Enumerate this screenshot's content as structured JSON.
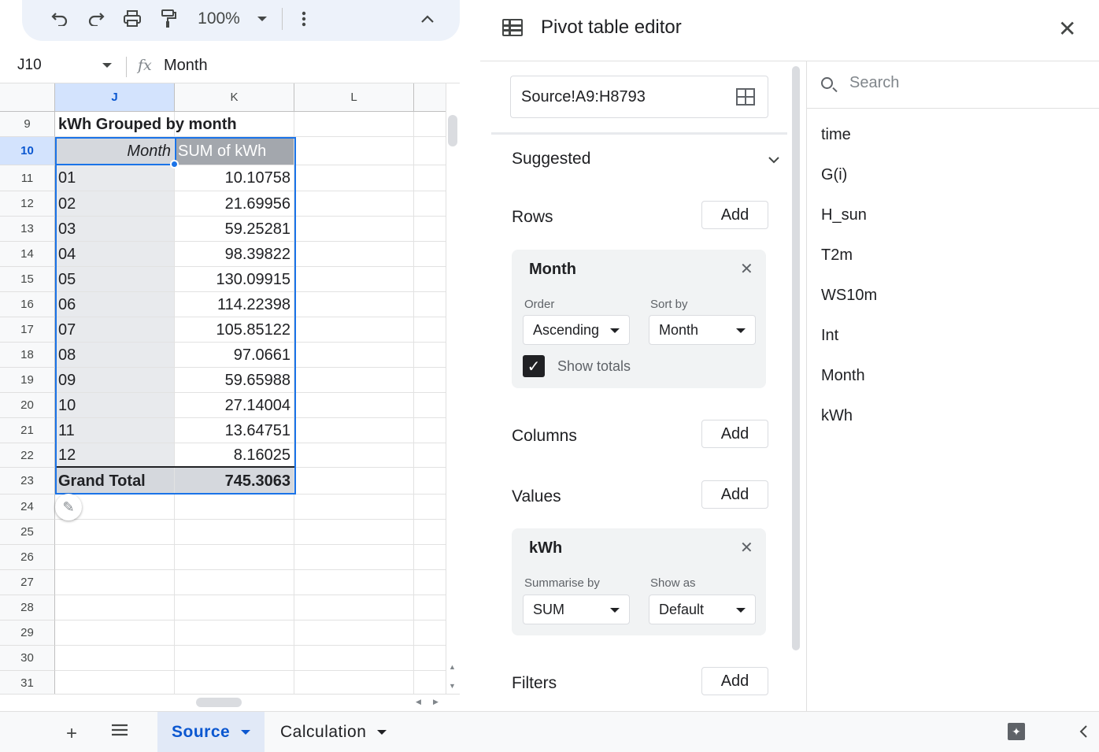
{
  "toolbar": {
    "zoom": "100%",
    "icons": [
      "undo-icon",
      "redo-icon",
      "print-icon",
      "paint-format-icon",
      "zoom-caret-icon",
      "more-vert-icon",
      "collapse-up-icon"
    ]
  },
  "formula_bar": {
    "name_box": "J10",
    "fx": "fx",
    "value": "Month"
  },
  "grid": {
    "columns": [
      "J",
      "K",
      "L"
    ],
    "rows": [
      {
        "num": "9",
        "j": "kWh Grouped by month",
        "k": ""
      },
      {
        "num": "10",
        "j": "Month",
        "k": "SUM of kWh"
      },
      {
        "num": "11",
        "j": "01",
        "k": "10.10758"
      },
      {
        "num": "12",
        "j": "02",
        "k": "21.69956"
      },
      {
        "num": "13",
        "j": "03",
        "k": "59.25281"
      },
      {
        "num": "14",
        "j": "04",
        "k": "98.39822"
      },
      {
        "num": "15",
        "j": "05",
        "k": "130.09915"
      },
      {
        "num": "16",
        "j": "06",
        "k": "114.22398"
      },
      {
        "num": "17",
        "j": "07",
        "k": "105.85122"
      },
      {
        "num": "18",
        "j": "08",
        "k": "97.0661"
      },
      {
        "num": "19",
        "j": "09",
        "k": "59.65988"
      },
      {
        "num": "20",
        "j": "10",
        "k": "27.14004"
      },
      {
        "num": "21",
        "j": "11",
        "k": "13.64751"
      },
      {
        "num": "22",
        "j": "12",
        "k": "8.16025"
      },
      {
        "num": "23",
        "j": "Grand Total",
        "k": "745.3063"
      },
      {
        "num": "24",
        "j": "",
        "k": ""
      },
      {
        "num": "25",
        "j": "",
        "k": ""
      },
      {
        "num": "26",
        "j": "",
        "k": ""
      },
      {
        "num": "27",
        "j": "",
        "k": ""
      },
      {
        "num": "28",
        "j": "",
        "k": ""
      },
      {
        "num": "29",
        "j": "",
        "k": ""
      },
      {
        "num": "30",
        "j": "",
        "k": ""
      },
      {
        "num": "31",
        "j": "",
        "k": ""
      }
    ]
  },
  "sheet_tabs": [
    {
      "label": "Source",
      "active": true
    },
    {
      "label": "Calculation",
      "active": false
    }
  ],
  "editor": {
    "title": "Pivot table editor",
    "source_range": "Source!A9:H8793",
    "suggested_label": "Suggested",
    "rows_label": "Rows",
    "columns_label": "Columns",
    "values_label": "Values",
    "filters_label": "Filters",
    "add_label": "Add",
    "row_card": {
      "title": "Month",
      "order_label": "Order",
      "order_value": "Ascending",
      "sortby_label": "Sort by",
      "sortby_value": "Month",
      "show_totals_label": "Show totals",
      "show_totals": true
    },
    "value_card": {
      "title": "kWh",
      "summarise_label": "Summarise by",
      "summarise_value": "SUM",
      "showas_label": "Show as",
      "showas_value": "Default"
    },
    "search_placeholder": "Search",
    "fields": [
      "time",
      "G(i)",
      "H_sun",
      "T2m",
      "WS10m",
      "Int",
      "Month",
      "kWh"
    ]
  },
  "colors": {
    "accent": "#1a73e8",
    "active_tab": "#0b57d0",
    "toolbar_bg": "#edf2fa"
  }
}
